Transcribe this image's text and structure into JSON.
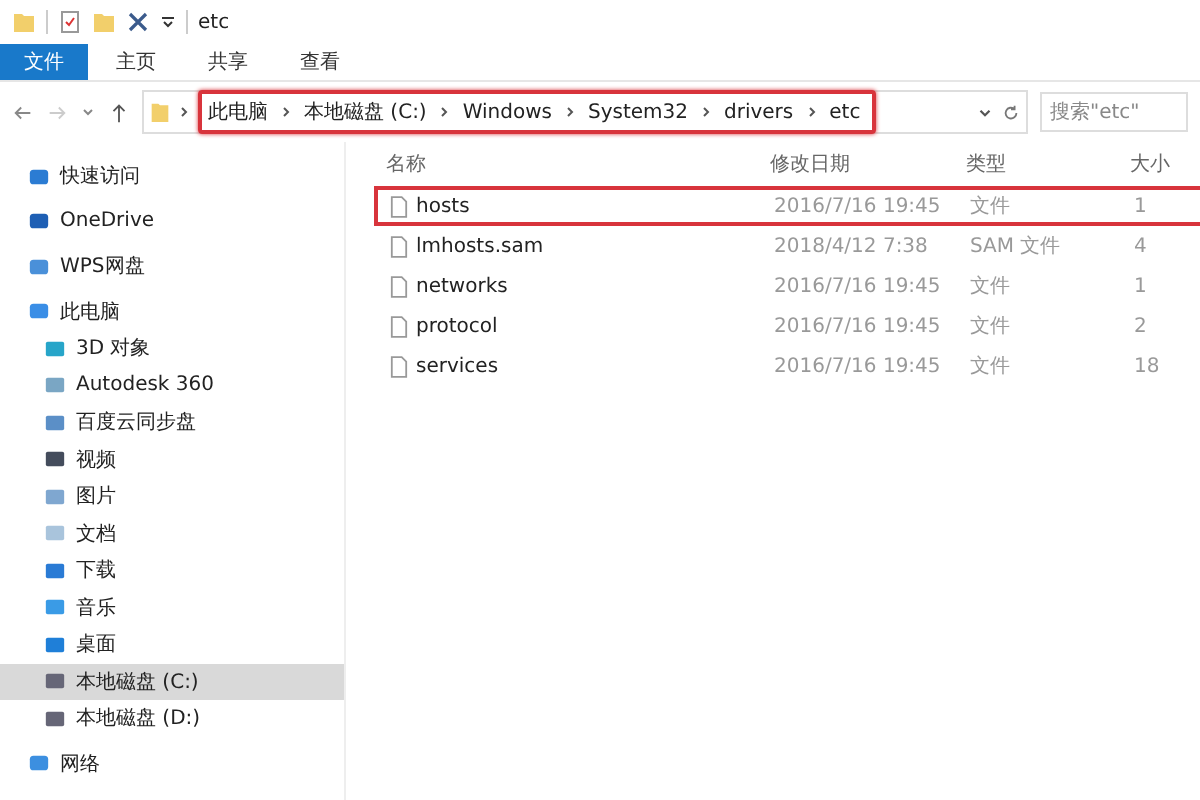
{
  "window": {
    "title": "etc"
  },
  "ribbon_tabs": [
    {
      "label": "文件",
      "selected": true
    },
    {
      "label": "主页",
      "selected": false
    },
    {
      "label": "共享",
      "selected": false
    },
    {
      "label": "查看",
      "selected": false
    }
  ],
  "address": {
    "highlighted": true,
    "path": [
      "此电脑",
      "本地磁盘 (C:)",
      "Windows",
      "System32",
      "drivers",
      "etc"
    ]
  },
  "search": {
    "placeholder": "搜索\"etc\""
  },
  "sidebar": {
    "items": [
      {
        "label": "快速访问",
        "kind": "star",
        "selected": false
      },
      {
        "label": "OneDrive",
        "kind": "cloud",
        "selected": false
      },
      {
        "label": "WPS网盘",
        "kind": "cloud-outline",
        "selected": false
      },
      {
        "label": "此电脑",
        "kind": "pc",
        "selected": false,
        "children": [
          {
            "label": "3D 对象",
            "kind": "cube",
            "selected": false
          },
          {
            "label": "Autodesk 360",
            "kind": "disc",
            "selected": false
          },
          {
            "label": "百度云同步盘",
            "kind": "sync",
            "selected": false
          },
          {
            "label": "视频",
            "kind": "video",
            "selected": false
          },
          {
            "label": "图片",
            "kind": "image",
            "selected": false
          },
          {
            "label": "文档",
            "kind": "doc",
            "selected": false
          },
          {
            "label": "下载",
            "kind": "download",
            "selected": false
          },
          {
            "label": "音乐",
            "kind": "music",
            "selected": false
          },
          {
            "label": "桌面",
            "kind": "desktop",
            "selected": false
          },
          {
            "label": "本地磁盘 (C:)",
            "kind": "drive-c",
            "selected": true
          },
          {
            "label": "本地磁盘 (D:)",
            "kind": "drive",
            "selected": false
          }
        ]
      },
      {
        "label": "网络",
        "kind": "network",
        "selected": false
      }
    ]
  },
  "table": {
    "columns": [
      "名称",
      "修改日期",
      "类型",
      "大小"
    ],
    "rows": [
      {
        "name": "hosts",
        "date": "2016/7/16 19:45",
        "type": "文件",
        "size": "1",
        "highlighted": true
      },
      {
        "name": "lmhosts.sam",
        "date": "2018/4/12 7:38",
        "type": "SAM 文件",
        "size": "4",
        "highlighted": false
      },
      {
        "name": "networks",
        "date": "2016/7/16 19:45",
        "type": "文件",
        "size": "1",
        "highlighted": false
      },
      {
        "name": "protocol",
        "date": "2016/7/16 19:45",
        "type": "文件",
        "size": "2",
        "highlighted": false
      },
      {
        "name": "services",
        "date": "2016/7/16 19:45",
        "type": "文件",
        "size": "18",
        "highlighted": false
      }
    ]
  }
}
